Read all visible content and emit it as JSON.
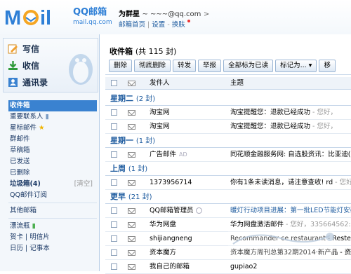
{
  "header": {
    "logo_text": "MOil",
    "brand": "QQ邮箱",
    "domain": "mail.qq.com",
    "user_name": "为群星",
    "user_email": "~      ~~~@qq.com",
    "links": [
      "邮箱首页",
      "设置",
      "换肤"
    ]
  },
  "sidebar": {
    "actions": [
      {
        "label": "写信",
        "icon": "pencil-icon"
      },
      {
        "label": "收信",
        "icon": "download-icon"
      },
      {
        "label": "通讯录",
        "icon": "contacts-icon"
      }
    ],
    "items": [
      {
        "label": "收件箱",
        "active": true
      },
      {
        "label": "重要联系人",
        "icon": "flag-icon"
      },
      {
        "label": "星标邮件",
        "icon": "star-icon"
      },
      {
        "label": "群邮件"
      },
      {
        "label": "草稿箱"
      },
      {
        "label": "已发送"
      },
      {
        "label": "已删除"
      },
      {
        "label": "垃圾箱(4)",
        "right": "[清空]"
      },
      {
        "label": "QQ邮件订阅"
      },
      {
        "label": "其他邮箱"
      },
      {
        "label": "漂流瓶"
      },
      {
        "label": "贺卡 | 明信片"
      },
      {
        "label": "日历 | 记事本"
      }
    ]
  },
  "main": {
    "folder_title": "收件箱",
    "folder_count": "(共 115 封)",
    "toolbar": [
      "删除",
      "彻底删除",
      "转发",
      "举报",
      "全部标为已读",
      "标记为...",
      "移"
    ],
    "columns": {
      "from": "发件人",
      "subject": "主题"
    },
    "groups": [
      {
        "label": "星期二",
        "count": "(2 封)",
        "rows": [
          {
            "from": "淘宝网",
            "subject": "淘宝提醒您：退款已经成功",
            "preview": " - 您好，"
          },
          {
            "from": "淘宝网",
            "subject": "淘宝提醒您：退款已经成功",
            "preview": " - 您好，"
          }
        ]
      },
      {
        "label": "星期一",
        "count": "(1 封)",
        "rows": [
          {
            "from": "广告邮件",
            "tag": "AD",
            "subject": "同花顺金融服务网: 自选股资讯：比亚迪(0"
          }
        ]
      },
      {
        "label": "上周",
        "count": "(1 封)",
        "rows": [
          {
            "from": "1373956714",
            "subject": "你有1条未读消息，请注意查收! rd",
            "preview": " - 您好"
          }
        ]
      },
      {
        "label": "更早",
        "count": "(21 封)",
        "rows": [
          {
            "from": "QQ邮箱管理员",
            "info": true,
            "subject": "暖灯行动项目进展：第一批LED节能灯安装",
            "blue": true
          },
          {
            "from": "华为网盘",
            "subject": "华为网盘激活邮件",
            "preview": " - 您好，335664562:"
          },
          {
            "from": "shijiangneng",
            "subject": "Recommander ce restaurant - Reste"
          },
          {
            "from": "资本魔方",
            "subject": "资本魔方周刊总第32期2014·新产品 - 资本"
          },
          {
            "from": "我自己的邮箱",
            "subject": "gupiao2"
          }
        ]
      }
    ]
  }
}
